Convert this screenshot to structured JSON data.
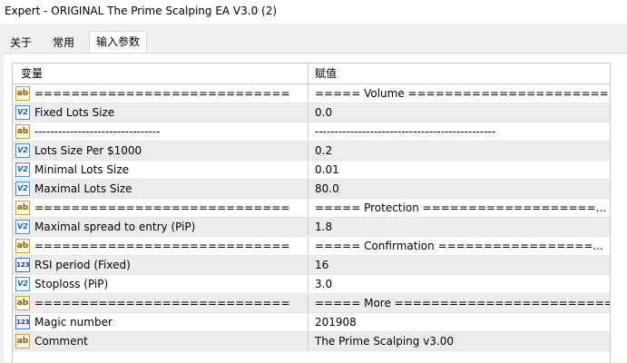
{
  "window": {
    "title": "Expert - ORIGINAL The Prime Scalping EA V3.0 (2)"
  },
  "tabs": [
    {
      "label": "关于"
    },
    {
      "label": "常用"
    },
    {
      "label": "输入参数"
    }
  ],
  "table": {
    "headers": {
      "variable": "变量",
      "value": "赋值"
    },
    "rows": [
      {
        "icon": "ab",
        "name": "============================",
        "value": "===== Volume ======================..."
      },
      {
        "icon": "v2",
        "name": "Fixed Lots Size",
        "value": "0.0"
      },
      {
        "icon": "ab",
        "name": "--------------------------------",
        "value": "----------------------------------------------"
      },
      {
        "icon": "v2",
        "name": "Lots Size Per $1000",
        "value": "0.2"
      },
      {
        "icon": "v2",
        "name": "Minimal Lots Size",
        "value": "0.01"
      },
      {
        "icon": "v2",
        "name": "Maximal Lots Size",
        "value": "80.0"
      },
      {
        "icon": "ab",
        "name": "============================",
        "value": "===== Protection ===================..."
      },
      {
        "icon": "v2",
        "name": "Maximal spread to entry (PiP)",
        "value": "1.8"
      },
      {
        "icon": "ab",
        "name": "============================",
        "value": "===== Confirmation =================..."
      },
      {
        "icon": "n123",
        "name": "RSI period (Fixed)",
        "value": "16"
      },
      {
        "icon": "v2",
        "name": "Stoploss (PiP)",
        "value": "3.0"
      },
      {
        "icon": "ab",
        "name": "============================",
        "value": "===== More ========================..."
      },
      {
        "icon": "n123",
        "name": "Magic number",
        "value": "201908"
      },
      {
        "icon": "ab",
        "name": "Comment",
        "value": "The Prime Scalping v3.00"
      }
    ]
  },
  "icon_glyphs": {
    "ab": "ab",
    "v2": "V2",
    "n123": "123"
  }
}
